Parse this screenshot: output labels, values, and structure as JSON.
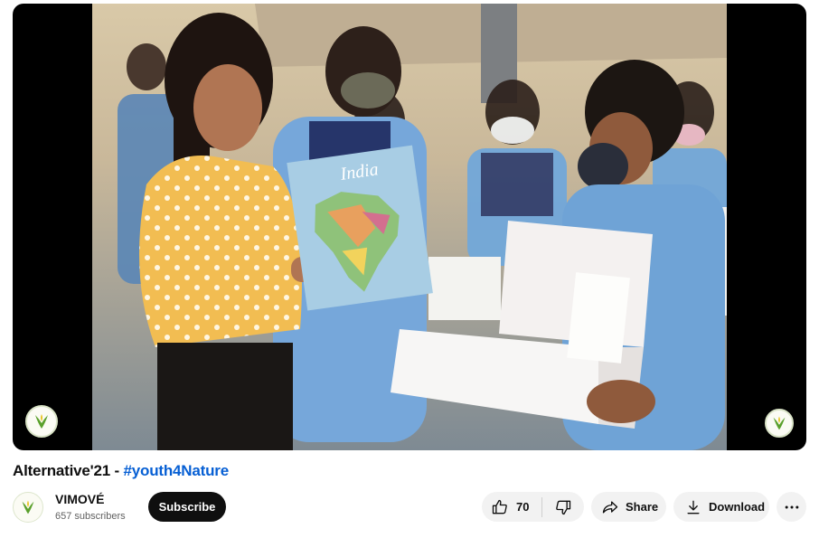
{
  "video": {
    "title_text": "Alternative'21 - ",
    "title_hashtag": "#youth4Nature",
    "channel_name": "VIMOVÉ",
    "subscribers": "657 subscribers",
    "subscribe_label": "Subscribe",
    "like_count": "70",
    "share_label": "Share",
    "download_label": "Download",
    "map_text": "India"
  },
  "icons": {
    "like": "thumbs-up-icon",
    "dislike": "thumbs-down-icon",
    "share": "share-arrow-icon",
    "download": "download-icon",
    "more": "more-horizontal-icon",
    "watermark": "vimove-logo"
  },
  "colors": {
    "hashtag": "#065fd4",
    "subscribe_bg": "#0f0f0f",
    "pill_bg": "#f2f2f2",
    "logo_green": "#5aa02c",
    "logo_yellow": "#e8c21a"
  }
}
